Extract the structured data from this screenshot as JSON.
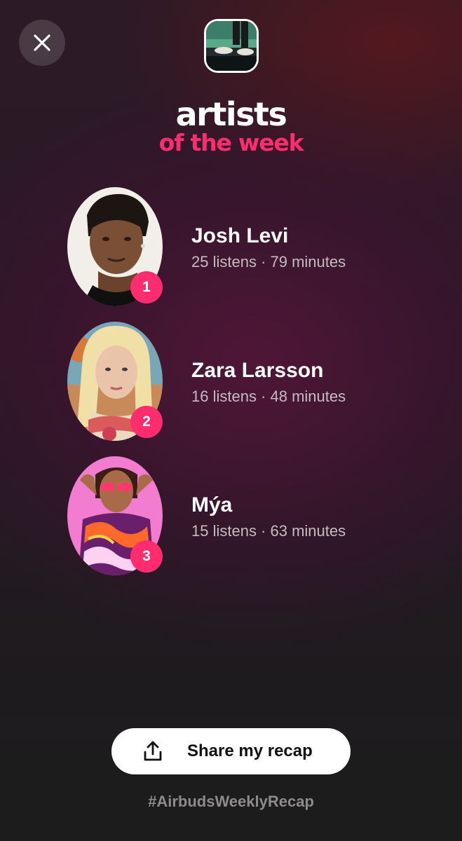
{
  "header": {
    "close_icon": "close-icon",
    "cover_icon": "album-cover-thumbnail"
  },
  "title": {
    "main": "artists",
    "sub": "of the week"
  },
  "artists": [
    {
      "rank": "1",
      "name": "Josh Levi",
      "stats": "25 listens · 79 minutes"
    },
    {
      "rank": "2",
      "name": "Zara Larsson",
      "stats": "16 listens · 48 minutes"
    },
    {
      "rank": "3",
      "name": "Mýa",
      "stats": "15 listens · 63 minutes"
    }
  ],
  "share": {
    "label": "Share my recap",
    "icon": "share-icon"
  },
  "hashtag": "#AirbudsWeeklyRecap",
  "colors": {
    "accent": "#ff2d6f",
    "stats_text": "#c4bcc1",
    "hashtag_text": "#8f8a8d",
    "button_bg": "#ffffff"
  }
}
